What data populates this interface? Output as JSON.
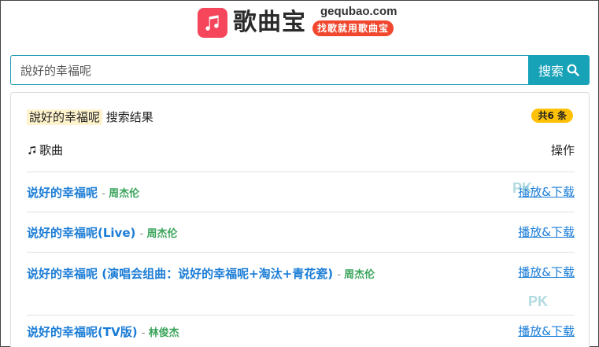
{
  "header": {
    "logo_icon": "music-note-icon",
    "app_name": "歌曲宝",
    "domain": "gequbao.com",
    "slogan": "找歌就用歌曲宝",
    "accent_color": "#f5465c"
  },
  "search": {
    "value": "說好的幸福呢",
    "button_label": "搜索",
    "button_icon": "search-icon",
    "button_color": "#17a2b8"
  },
  "results": {
    "query": "說好的幸福呢",
    "title_suffix": "搜索结果",
    "count_badge": "共6 条",
    "col_song_label": "歌曲",
    "col_song_icon": "music-note-icon",
    "col_action_label": "操作",
    "rows": [
      {
        "title": "说好的幸福呢",
        "artist": "周杰伦",
        "action": "播放&下载"
      },
      {
        "title": "说好的幸福呢(Live)",
        "artist": "周杰伦",
        "action": "播放&下载"
      },
      {
        "title": "说好的幸福呢 (演唱会组曲：说好的幸福呢+淘汰+青花瓷)",
        "artist": "周杰伦",
        "action": "播放&下载"
      },
      {
        "title": "说好的幸福呢(TV版)",
        "artist": "林俊杰",
        "action": "播放&下载"
      }
    ]
  },
  "watermark": "PK"
}
